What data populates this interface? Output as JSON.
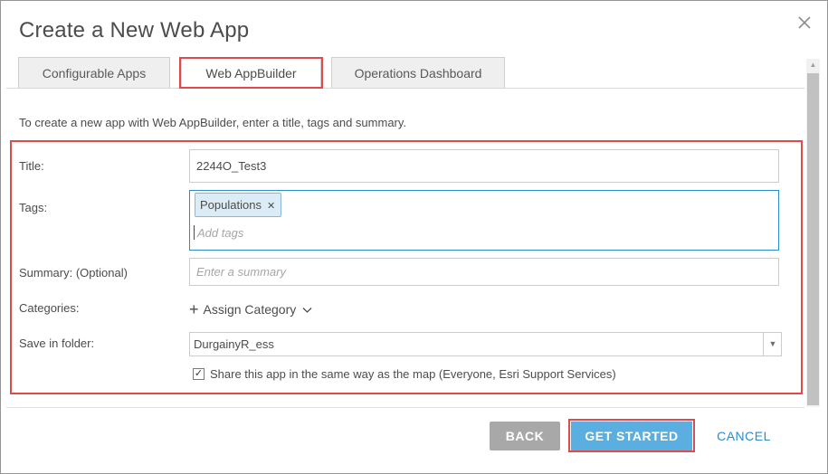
{
  "dialog": {
    "title": "Create a New Web App",
    "close_icon": "close-icon"
  },
  "tabs": [
    {
      "label": "Configurable Apps",
      "active": false
    },
    {
      "label": "Web AppBuilder",
      "active": true
    },
    {
      "label": "Operations Dashboard",
      "active": false
    }
  ],
  "intro": "To create a new app with Web AppBuilder, enter a title, tags and summary.",
  "form": {
    "title_label": "Title:",
    "title_value": "2244O_Test3",
    "tags_label": "Tags:",
    "tags": [
      "Populations"
    ],
    "tags_placeholder": "Add tags",
    "summary_label": "Summary: (Optional)",
    "summary_placeholder": "Enter a summary",
    "categories_label": "Categories:",
    "assign_category": "Assign Category",
    "folder_label": "Save in folder:",
    "folder_value": "DurgainyR_ess",
    "share_checked": true,
    "share_label": "Share this app in the same way as the map (Everyone, Esri Support Services)"
  },
  "buttons": {
    "back": "BACK",
    "get_started": "GET STARTED",
    "cancel": "CANCEL"
  },
  "colors": {
    "highlight": "#e04a4a",
    "primary": "#5aafe0",
    "link": "#2b8ccc",
    "disabled": "#a8a8a8"
  }
}
